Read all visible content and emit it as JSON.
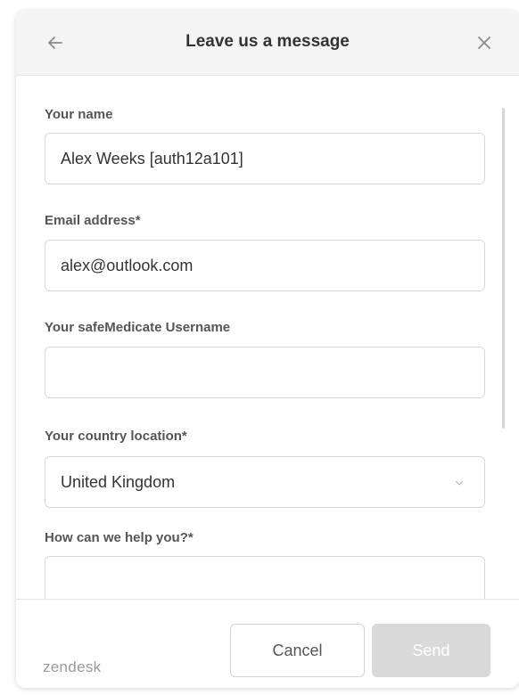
{
  "header": {
    "title": "Leave us a message",
    "back_icon": "arrow-left-icon",
    "close_icon": "close-icon"
  },
  "form": {
    "name": {
      "label": "Your name",
      "value": "Alex Weeks [auth12a101]"
    },
    "email": {
      "label": "Email address*",
      "value": "alex@outlook.com"
    },
    "username": {
      "label": "Your safeMedicate Username",
      "value": ""
    },
    "country": {
      "label": "Your country location*",
      "value": "United Kingdom",
      "icon": "chevron-down-icon"
    },
    "help": {
      "label": "How can we help you?*",
      "value": ""
    }
  },
  "footer": {
    "brand": "zendesk",
    "cancel_label": "Cancel",
    "send_label": "Send"
  },
  "colors": {
    "header_bg": "#f4f4f4",
    "label": "#555555",
    "send_disabled_bg": "#d9d9d9",
    "brand": "#9a9a9a"
  }
}
